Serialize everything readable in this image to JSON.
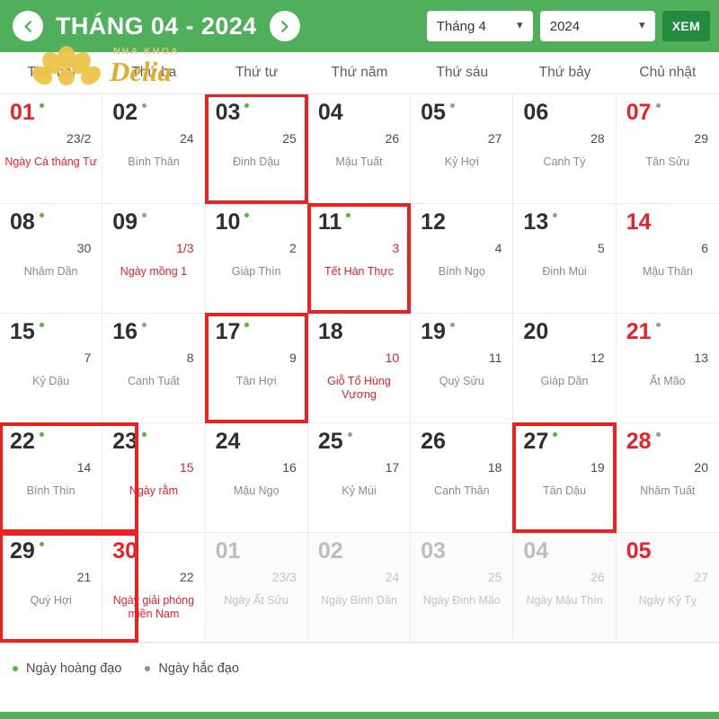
{
  "header": {
    "prev_icon": "chevron-left-icon",
    "next_icon": "chevron-right-icon",
    "title": "THÁNG 04 - 2024",
    "month_select_value": "Tháng 4",
    "year_select_value": "2024",
    "view_button_label": "XEM",
    "accent_color": "#4faf5a",
    "button_color": "#248a3d"
  },
  "watermark": {
    "line1": "NHA KHOA",
    "line2": "Delia",
    "color": "#e9b949"
  },
  "weekdays": [
    "Thứ hai",
    "Thứ ba",
    "Thứ tư",
    "Thứ năm",
    "Thứ sáu",
    "Thứ bảy",
    "Chủ nhật"
  ],
  "legend": [
    {
      "dot": "good",
      "label": "Ngày hoàng đạo"
    },
    {
      "dot": "bad",
      "label": "Ngày hắc đạo"
    }
  ],
  "days": [
    {
      "solar": "01",
      "lunar": "23/2",
      "note": "Ngày Cá tháng Tư",
      "dot": "good",
      "red": true,
      "note_red": true,
      "boxed": false,
      "other": false
    },
    {
      "solar": "02",
      "lunar": "24",
      "note": "Bính Thân",
      "dot": "bad",
      "red": false,
      "note_red": false,
      "boxed": false,
      "other": false
    },
    {
      "solar": "03",
      "lunar": "25",
      "note": "Đinh Dậu",
      "dot": "good",
      "red": false,
      "note_red": false,
      "boxed": true,
      "other": false
    },
    {
      "solar": "04",
      "lunar": "26",
      "note": "Mậu Tuất",
      "dot": "",
      "red": false,
      "note_red": false,
      "boxed": false,
      "other": false
    },
    {
      "solar": "05",
      "lunar": "27",
      "note": "Kỷ Hợi",
      "dot": "bad",
      "red": false,
      "note_red": false,
      "boxed": false,
      "other": false
    },
    {
      "solar": "06",
      "lunar": "28",
      "note": "Canh Tý",
      "dot": "",
      "red": false,
      "note_red": false,
      "boxed": false,
      "other": false
    },
    {
      "solar": "07",
      "lunar": "29",
      "note": "Tân Sửu",
      "dot": "bad",
      "red": true,
      "note_red": false,
      "boxed": false,
      "other": false
    },
    {
      "solar": "08",
      "lunar": "30",
      "note": "Nhâm Dần",
      "dot": "good",
      "red": false,
      "note_red": false,
      "boxed": false,
      "other": false
    },
    {
      "solar": "09",
      "lunar": "1/3",
      "note": "Ngày mồng 1",
      "dot": "bad",
      "red": false,
      "note_red": true,
      "boxed": false,
      "other": false,
      "lunar_red": true
    },
    {
      "solar": "10",
      "lunar": "2",
      "note": "Giáp Thìn",
      "dot": "good",
      "red": false,
      "note_red": false,
      "boxed": false,
      "other": false
    },
    {
      "solar": "11",
      "lunar": "3",
      "note": "Tết Hàn Thực",
      "dot": "good",
      "red": false,
      "note_red": true,
      "boxed": true,
      "other": false,
      "lunar_red": true
    },
    {
      "solar": "12",
      "lunar": "4",
      "note": "Bính Ngọ",
      "dot": "",
      "red": false,
      "note_red": false,
      "boxed": false,
      "other": false
    },
    {
      "solar": "13",
      "lunar": "5",
      "note": "Đinh Mùi",
      "dot": "bad",
      "red": false,
      "note_red": false,
      "boxed": false,
      "other": false
    },
    {
      "solar": "14",
      "lunar": "6",
      "note": "Mậu Thân",
      "dot": "",
      "red": true,
      "note_red": false,
      "boxed": false,
      "other": false
    },
    {
      "solar": "15",
      "lunar": "7",
      "note": "Kỷ Dậu",
      "dot": "good",
      "red": false,
      "note_red": false,
      "boxed": false,
      "other": false
    },
    {
      "solar": "16",
      "lunar": "8",
      "note": "Canh Tuất",
      "dot": "bad",
      "red": false,
      "note_red": false,
      "boxed": false,
      "other": false
    },
    {
      "solar": "17",
      "lunar": "9",
      "note": "Tân Hợi",
      "dot": "good",
      "red": false,
      "note_red": false,
      "boxed": true,
      "other": false
    },
    {
      "solar": "18",
      "lunar": "10",
      "note": "Giỗ Tổ Hùng Vương",
      "dot": "",
      "red": false,
      "note_red": true,
      "boxed": false,
      "other": false,
      "lunar_red": true
    },
    {
      "solar": "19",
      "lunar": "11",
      "note": "Quý Sửu",
      "dot": "bad",
      "red": false,
      "note_red": false,
      "boxed": false,
      "other": false
    },
    {
      "solar": "20",
      "lunar": "12",
      "note": "Giáp Dần",
      "dot": "",
      "red": false,
      "note_red": false,
      "boxed": false,
      "other": false
    },
    {
      "solar": "21",
      "lunar": "13",
      "note": "Ất Mão",
      "dot": "bad",
      "red": true,
      "note_red": false,
      "boxed": false,
      "other": false
    },
    {
      "solar": "22",
      "lunar": "14",
      "note": "Bính Thìn",
      "dot": "good",
      "red": false,
      "note_red": false,
      "boxed": true,
      "boxed_wide": true,
      "other": false
    },
    {
      "solar": "23",
      "lunar": "15",
      "note": "Ngày rằm",
      "dot": "good",
      "red": false,
      "note_red": true,
      "boxed": false,
      "other": false,
      "lunar_red": true
    },
    {
      "solar": "24",
      "lunar": "16",
      "note": "Mậu Ngọ",
      "dot": "",
      "red": false,
      "note_red": false,
      "boxed": false,
      "other": false
    },
    {
      "solar": "25",
      "lunar": "17",
      "note": "Kỷ Mùi",
      "dot": "bad",
      "red": false,
      "note_red": false,
      "boxed": false,
      "other": false
    },
    {
      "solar": "26",
      "lunar": "18",
      "note": "Canh Thân",
      "dot": "",
      "red": false,
      "note_red": false,
      "boxed": false,
      "other": false
    },
    {
      "solar": "27",
      "lunar": "19",
      "note": "Tân Dậu",
      "dot": "good",
      "red": false,
      "note_red": false,
      "boxed": true,
      "other": false
    },
    {
      "solar": "28",
      "lunar": "20",
      "note": "Nhâm Tuất",
      "dot": "bad",
      "red": true,
      "note_red": false,
      "boxed": false,
      "other": false
    },
    {
      "solar": "29",
      "lunar": "21",
      "note": "Quý Hợi",
      "dot": "good",
      "red": false,
      "note_red": false,
      "boxed": true,
      "boxed_wide": true,
      "other": false
    },
    {
      "solar": "30",
      "lunar": "22",
      "note": "Ngày giải phóng miền Nam",
      "dot": "",
      "red": true,
      "note_red": true,
      "boxed": false,
      "other": false
    },
    {
      "solar": "01",
      "lunar": "23/3",
      "note": "Ngày Ất Sửu",
      "dot": "",
      "red": false,
      "note_red": false,
      "boxed": false,
      "other": true
    },
    {
      "solar": "02",
      "lunar": "24",
      "note": "Ngày Bính Dần",
      "dot": "",
      "red": false,
      "note_red": false,
      "boxed": false,
      "other": true
    },
    {
      "solar": "03",
      "lunar": "25",
      "note": "Ngày Đinh Mão",
      "dot": "",
      "red": false,
      "note_red": false,
      "boxed": false,
      "other": true
    },
    {
      "solar": "04",
      "lunar": "26",
      "note": "Ngày Mậu Thìn",
      "dot": "",
      "red": false,
      "note_red": false,
      "boxed": false,
      "other": true
    },
    {
      "solar": "05",
      "lunar": "27",
      "note": "Ngày Kỷ Tỵ",
      "dot": "",
      "red": true,
      "note_red": false,
      "boxed": false,
      "other": true
    }
  ]
}
